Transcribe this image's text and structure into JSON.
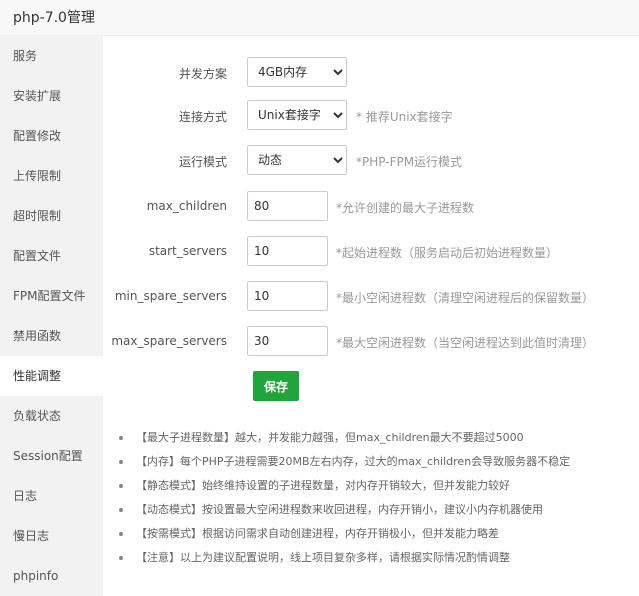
{
  "window": {
    "title": "php-7.0管理"
  },
  "sidebar": {
    "items": [
      {
        "label": "服务"
      },
      {
        "label": "安装扩展"
      },
      {
        "label": "配置修改"
      },
      {
        "label": "上传限制"
      },
      {
        "label": "超时限制"
      },
      {
        "label": "配置文件"
      },
      {
        "label": "FPM配置文件"
      },
      {
        "label": "禁用函数"
      },
      {
        "label": "性能调整",
        "active": true
      },
      {
        "label": "负载状态"
      },
      {
        "label": "Session配置"
      },
      {
        "label": "日志"
      },
      {
        "label": "慢日志"
      },
      {
        "label": "phpinfo"
      }
    ]
  },
  "form": {
    "concurrency": {
      "label": "并发方案",
      "value": "4GB内存"
    },
    "connection": {
      "label": "连接方式",
      "value": "Unix套接字",
      "hint": "* 推荐Unix套接字"
    },
    "run_mode": {
      "label": "运行模式",
      "value": "动态",
      "hint": "*PHP-FPM运行模式"
    },
    "max_children": {
      "label": "max_children",
      "value": "80",
      "hint": "*允许创建的最大子进程数"
    },
    "start_servers": {
      "label": "start_servers",
      "value": "10",
      "hint": "*起始进程数（服务启动后初始进程数量）"
    },
    "min_spare_servers": {
      "label": "min_spare_servers",
      "value": "10",
      "hint": "*最小空闲进程数（清理空闲进程后的保留数量）"
    },
    "max_spare_servers": {
      "label": "max_spare_servers",
      "value": "30",
      "hint": "*最大空闲进程数（当空闲进程达到此值时清理）"
    },
    "save_label": "保存"
  },
  "notes": [
    "【最大子进程数量】越大，并发能力越强，但max_children最大不要超过5000",
    "【内存】每个PHP子进程需要20MB左右内存，过大的max_children会导致服务器不稳定",
    "【静态模式】始终维持设置的子进程数量，对内存开销较大，但并发能力较好",
    "【动态模式】按设置最大空闲进程数来收回进程，内存开销小，建议小内存机器使用",
    "【按需模式】根据访问需求自动创建进程，内存开销极小，但并发能力略差",
    "【注意】以上为建议配置说明，线上项目复杂多样，请根据实际情况酌情调整"
  ]
}
